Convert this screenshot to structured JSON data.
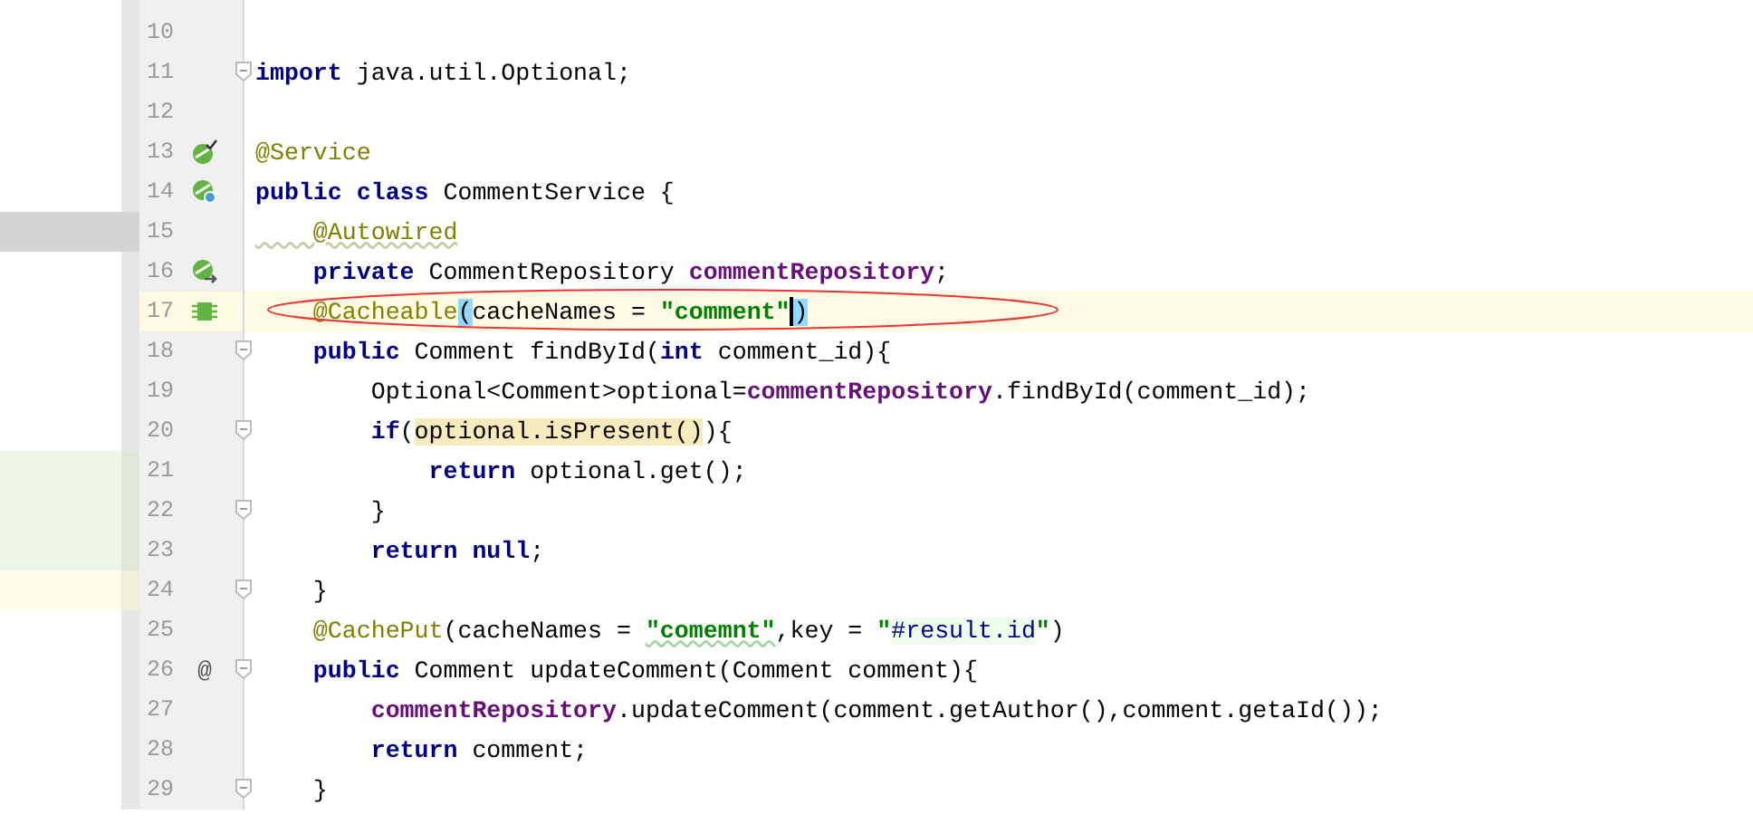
{
  "editor": {
    "lines": [
      {
        "number": "10"
      },
      {
        "number": "11",
        "fold": true,
        "tokens": [
          {
            "kind": "keyword",
            "text": "import"
          },
          {
            "kind": "plain",
            "text": " java.util.Optional;"
          }
        ]
      },
      {
        "number": "12"
      },
      {
        "number": "13",
        "gutter_icon": {
          "kind": "bean-check"
        },
        "tokens": [
          {
            "kind": "annotation",
            "text": "@Service"
          }
        ]
      },
      {
        "number": "14",
        "gutter_icon": {
          "kind": "bean-search"
        },
        "tokens": [
          {
            "kind": "keyword",
            "text": "public class"
          },
          {
            "kind": "plain",
            "text": " CommentService {"
          }
        ]
      },
      {
        "number": "15",
        "marker": {
          "kind": "selected"
        },
        "tokens": [
          {
            "kind": "annotation-warn",
            "text": "    @Autowired"
          }
        ]
      },
      {
        "number": "16",
        "gutter_icon": {
          "kind": "bean-arrow"
        },
        "tokens": [
          {
            "kind": "keyword",
            "text": "    private"
          },
          {
            "kind": "plain",
            "text": " CommentRepository "
          },
          {
            "kind": "field",
            "text": "commentRepository"
          },
          {
            "kind": "plain",
            "text": ";"
          }
        ]
      },
      {
        "number": "17",
        "gutter_icon": {
          "kind": "cache"
        },
        "current": true,
        "tokens": [
          {
            "kind": "annotation",
            "text": "    @Cacheable"
          },
          {
            "kind": "brace-match",
            "text": "("
          },
          {
            "kind": "plain",
            "text": "cacheNames = "
          },
          {
            "kind": "string",
            "text": "\"comment\""
          },
          {
            "kind": "caret"
          },
          {
            "kind": "brace-match",
            "text": ")"
          }
        ]
      },
      {
        "number": "18",
        "fold": true,
        "tokens": [
          {
            "kind": "keyword",
            "text": "    public"
          },
          {
            "kind": "plain",
            "text": " Comment findById("
          },
          {
            "kind": "keyword",
            "text": "int"
          },
          {
            "kind": "plain",
            "text": " comment_id){"
          }
        ]
      },
      {
        "number": "19",
        "tokens": [
          {
            "kind": "plain",
            "text": "        Optional<Comment>optional="
          },
          {
            "kind": "field",
            "text": "commentRepository"
          },
          {
            "kind": "plain",
            "text": ".findById(comment_id);"
          }
        ]
      },
      {
        "number": "20",
        "fold": true,
        "tokens": [
          {
            "kind": "keyword",
            "text": "        if"
          },
          {
            "kind": "plain",
            "text": "("
          },
          {
            "kind": "highlight",
            "text": "optional.isPresent()"
          },
          {
            "kind": "plain",
            "text": "){"
          }
        ]
      },
      {
        "number": "21",
        "marker": {
          "kind": "added"
        },
        "tokens": [
          {
            "kind": "keyword",
            "text": "            return"
          },
          {
            "kind": "plain",
            "text": " optional.get();"
          }
        ]
      },
      {
        "number": "22",
        "fold": true,
        "marker": {
          "kind": "added"
        },
        "tokens": [
          {
            "kind": "plain",
            "text": "        }"
          }
        ]
      },
      {
        "number": "23",
        "marker": {
          "kind": "added"
        },
        "tokens": [
          {
            "kind": "keyword",
            "text": "        return null"
          },
          {
            "kind": "plain",
            "text": ";"
          }
        ]
      },
      {
        "number": "24",
        "fold": true,
        "marker": {
          "kind": "changed"
        },
        "tokens": [
          {
            "kind": "plain",
            "text": "    }"
          }
        ]
      },
      {
        "number": "25",
        "tokens": [
          {
            "kind": "annotation",
            "text": "    @CachePut"
          },
          {
            "kind": "plain",
            "text": "(cacheNames = "
          },
          {
            "kind": "string-warn",
            "text": "\"comemnt\""
          },
          {
            "kind": "plain",
            "text": ",key = "
          },
          {
            "kind": "string",
            "text": "\""
          },
          {
            "kind": "spel",
            "text": "#result.id"
          },
          {
            "kind": "string",
            "text": "\""
          },
          {
            "kind": "plain",
            "text": ")"
          }
        ]
      },
      {
        "number": "26",
        "fold": true,
        "gutter_text": "@",
        "tokens": [
          {
            "kind": "keyword",
            "text": "    public"
          },
          {
            "kind": "plain",
            "text": " Comment updateComment(Comment comment){"
          }
        ]
      },
      {
        "number": "27",
        "tokens": [
          {
            "kind": "field",
            "text": "        commentRepository"
          },
          {
            "kind": "plain",
            "text": ".updateComment(comment.getAuthor(),comment.getaId());"
          }
        ]
      },
      {
        "number": "28",
        "tokens": [
          {
            "kind": "keyword",
            "text": "        return"
          },
          {
            "kind": "plain",
            "text": " comment;"
          }
        ]
      },
      {
        "number": "29",
        "fold": true,
        "tokens": [
          {
            "kind": "plain",
            "text": "    }"
          }
        ]
      }
    ]
  }
}
